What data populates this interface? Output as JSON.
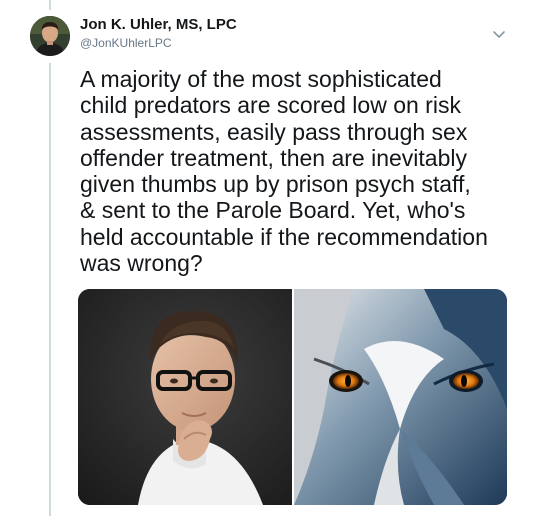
{
  "tweet": {
    "author": {
      "display_name": "Jon K. Uhler, MS, LPC",
      "handle": "@JonKUhlerLPC"
    },
    "menu_icon": "chevron-down-icon",
    "text": "A majority of the most sophisticated\nchild predators are scored low on risk\nassessments, easily pass through sex\noffender treatment, then are inevitably\ngiven thumbs up by prison psych staff,\n& sent to the Parole Board. Yet, who's\nheld accountable if the recommendation\nwas wrong?",
    "media": [
      {
        "subject": "man-with-glasses-portrait"
      },
      {
        "subject": "wolf-face-closeup"
      }
    ]
  },
  "colors": {
    "text": "#14171a",
    "secondary_text": "#657786",
    "thread_line": "#cfd9de"
  }
}
